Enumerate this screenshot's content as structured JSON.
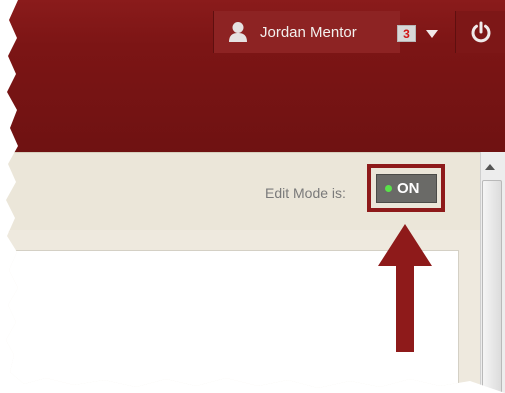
{
  "header": {
    "user": {
      "name": "Jordan Mentor",
      "icon": "user-icon"
    },
    "notifications": {
      "count": "3"
    },
    "menu": {
      "icon": "chevron-down-icon"
    },
    "logout": {
      "icon": "power-icon"
    }
  },
  "toolbar": {
    "edit_mode_label": "Edit Mode is:",
    "edit_mode_value": "ON",
    "edit_mode_status_color": "#59e24a"
  },
  "annotation": {
    "arrow_color": "#8e1a1a",
    "highlight_color": "#8e1a1a"
  },
  "colors": {
    "header": "#7c1515",
    "toolbar": "#ebe6d9"
  }
}
